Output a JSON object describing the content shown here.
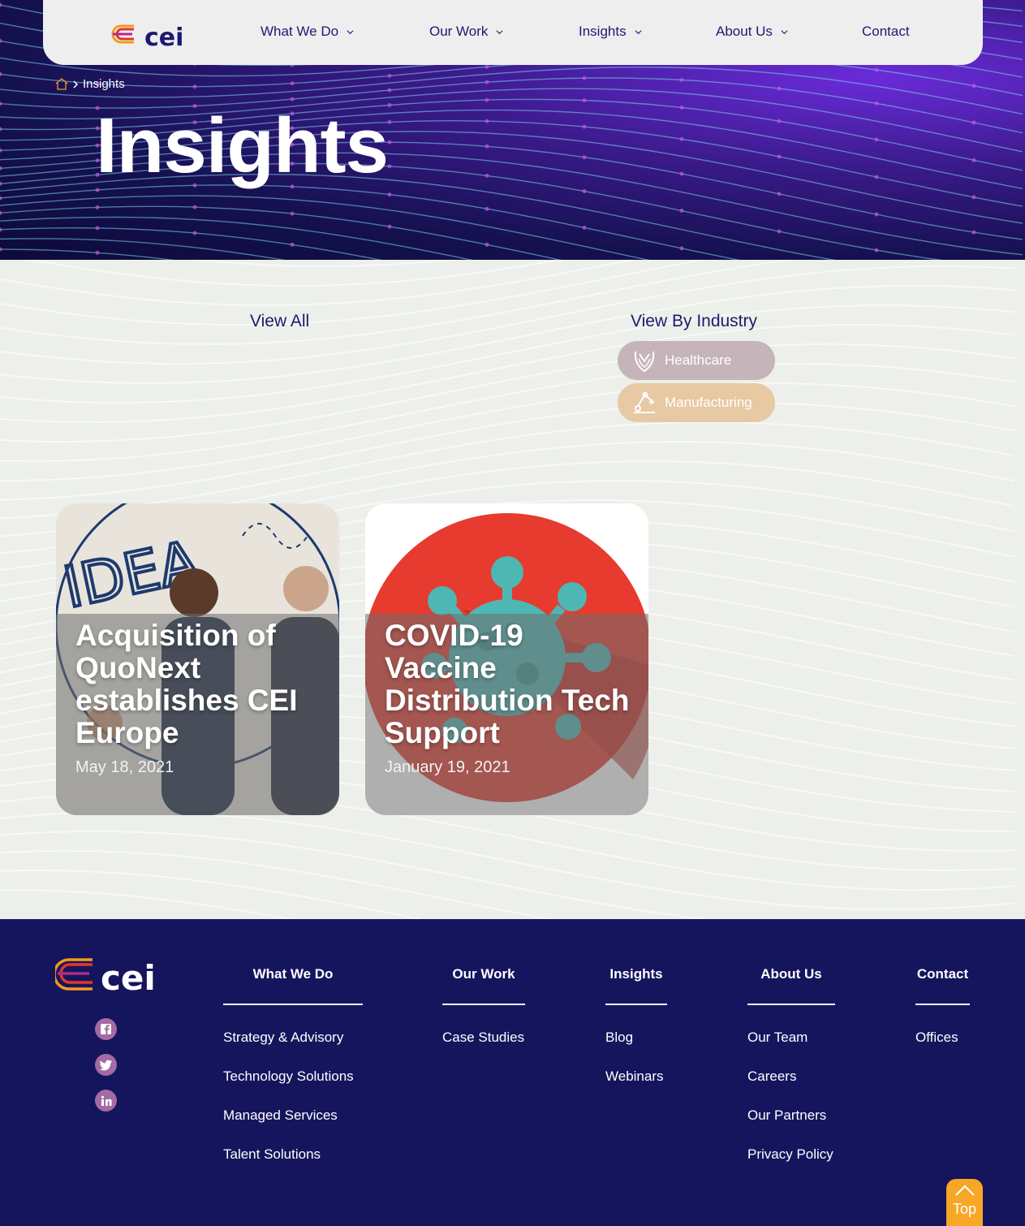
{
  "nav": {
    "items": [
      {
        "label": "What We Do",
        "has_dropdown": true
      },
      {
        "label": "Our Work",
        "has_dropdown": true
      },
      {
        "label": "Insights",
        "has_dropdown": true
      },
      {
        "label": "About Us",
        "has_dropdown": true
      },
      {
        "label": "Contact",
        "has_dropdown": false
      }
    ]
  },
  "breadcrumb": {
    "current": "Insights"
  },
  "hero": {
    "title": "Insights"
  },
  "filters": {
    "view_all": "View All",
    "view_by_industry": "View By Industry",
    "industries": [
      {
        "label": "Healthcare",
        "icon": "healthcare-hands-icon",
        "color": "#c6b4bb"
      },
      {
        "label": "Manufacturing",
        "icon": "robot-arm-icon",
        "color": "#e7c9a4"
      }
    ]
  },
  "cards": [
    {
      "title": "Acquisition of QuoNext establishes CEI Europe",
      "date": "May 18, 2021"
    },
    {
      "title": "COVID-19 Vaccine Distribution Tech Support",
      "date": "January 19, 2021"
    }
  ],
  "footer": {
    "social": [
      "facebook-icon",
      "twitter-icon",
      "linkedin-icon"
    ],
    "columns": [
      {
        "heading": "What We Do",
        "links": [
          "Strategy & Advisory",
          "Technology Solutions",
          "Managed Services",
          "Talent Solutions"
        ]
      },
      {
        "heading": "Our Work",
        "links": [
          "Case Studies"
        ]
      },
      {
        "heading": "Insights",
        "links": [
          "Blog",
          "Webinars"
        ]
      },
      {
        "heading": "About Us",
        "links": [
          "Our Team",
          "Careers",
          "Our Partners",
          "Privacy Policy"
        ]
      },
      {
        "heading": "Contact",
        "links": [
          "Offices"
        ]
      }
    ]
  },
  "top_button": {
    "label": "Top"
  },
  "colors": {
    "navy": "#15155e",
    "nav_text": "#1d1a6e",
    "accent_orange": "#f7a626",
    "logo_red": "#e4362b"
  }
}
